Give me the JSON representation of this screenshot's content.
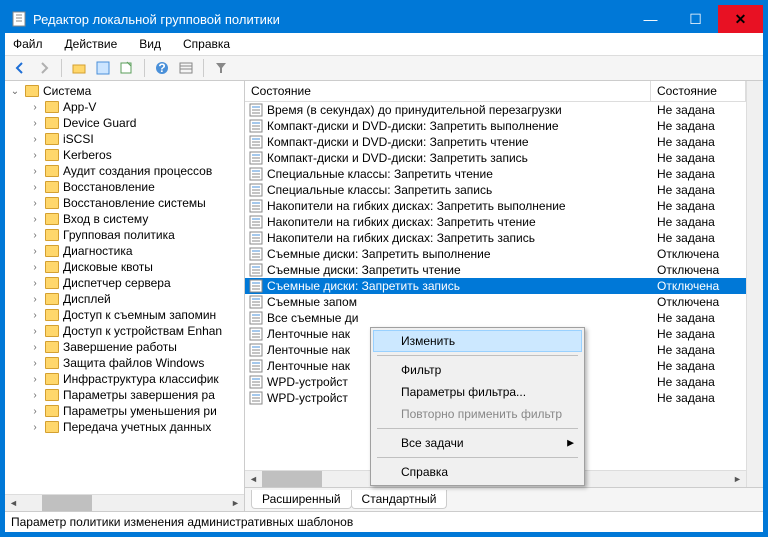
{
  "title": "Редактор локальной групповой политики",
  "menu": [
    "Файл",
    "Действие",
    "Вид",
    "Справка"
  ],
  "tree": {
    "root": "Система",
    "items": [
      "App-V",
      "Device Guard",
      "iSCSI",
      "Kerberos",
      "Аудит создания процессов",
      "Восстановление",
      "Восстановление системы",
      "Вход в систему",
      "Групповая политика",
      "Диагностика",
      "Дисковые квоты",
      "Диспетчер сервера",
      "Дисплей",
      "Доступ к съемным запомин",
      "Доступ к устройствам Enhan",
      "Завершение работы",
      "Защита файлов Windows",
      "Инфраструктура классифик",
      "Параметры завершения ра",
      "Параметры уменьшения ри",
      "Передача учетных данных"
    ]
  },
  "columns": {
    "name": "Состояние",
    "state": "Состояние"
  },
  "rows": [
    {
      "name": "Время (в секундах) до принудительной перезагрузки",
      "state": "Не задана"
    },
    {
      "name": "Компакт-диски и DVD-диски: Запретить выполнение",
      "state": "Не задана"
    },
    {
      "name": "Компакт-диски и DVD-диски: Запретить чтение",
      "state": "Не задана"
    },
    {
      "name": "Компакт-диски и DVD-диски: Запретить запись",
      "state": "Не задана"
    },
    {
      "name": "Специальные классы: Запретить чтение",
      "state": "Не задана"
    },
    {
      "name": "Специальные классы: Запретить запись",
      "state": "Не задана"
    },
    {
      "name": "Накопители на гибких дисках: Запретить выполнение",
      "state": "Не задана"
    },
    {
      "name": "Накопители на гибких дисках: Запретить чтение",
      "state": "Не задана"
    },
    {
      "name": "Накопители на гибких дисках: Запретить запись",
      "state": "Не задана"
    },
    {
      "name": "Съемные диски: Запретить выполнение",
      "state": "Отключена"
    },
    {
      "name": "Съемные диски: Запретить чтение",
      "state": "Отключена"
    },
    {
      "name": "Съемные диски: Запретить запись",
      "state": "Отключена",
      "selected": true
    },
    {
      "name": "Съемные запом",
      "state": "Отключена"
    },
    {
      "name": "Все съемные ди",
      "state": "Не задана"
    },
    {
      "name": "Ленточные нак",
      "state": "Не задана"
    },
    {
      "name": "Ленточные нак",
      "state": "Не задана"
    },
    {
      "name": "Ленточные нак",
      "state": "Не задана"
    },
    {
      "name": "WPD-устройст",
      "state": "Не задана"
    },
    {
      "name": "WPD-устройст",
      "state": "Не задана"
    }
  ],
  "context": {
    "edit": "Изменить",
    "filter": "Фильтр",
    "filterParams": "Параметры фильтра...",
    "reapply": "Повторно применить фильтр",
    "allTasks": "Все задачи",
    "help": "Справка"
  },
  "tabs": {
    "extended": "Расширенный",
    "standard": "Стандартный"
  },
  "status": "Параметр политики изменения административных шаблонов"
}
